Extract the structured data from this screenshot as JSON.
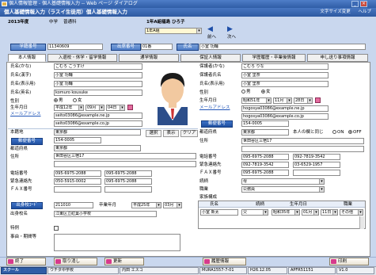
{
  "window": {
    "title": "個人情報管理 - 個人基礎情報入力 -- Web ページ ダイアログ",
    "min": "_",
    "max": "□",
    "close": "×"
  },
  "menubar": {
    "title": "個人基礎情報入力（ラスイ生徒用）個人基礎情報入力",
    "font_size": "文字サイズ変更",
    "help": "ヘルプ"
  },
  "header": {
    "year_label": "2013年度",
    "school_type": "中学",
    "course": "普通科",
    "class_info": "1年A組福島 ひろ子",
    "class_select": "1年A組",
    "prev": "前へ",
    "next": "次へ",
    "student_no_label": "学籍番号",
    "student_no": "11340609",
    "attendance_label": "出席番号",
    "attendance_no": "01番",
    "name_label": "氏名",
    "name": "小室 功輔"
  },
  "tabs": [
    "本人情報",
    "入退校・休学・留学情報",
    "通学情報",
    "保証人情報",
    "学歴履歴・卒業後情報",
    "申し送り事項情報"
  ],
  "left": {
    "kana_label": "氏名(かな)",
    "kana": "こむろ こうすけ",
    "kanji_label": "氏名(漢字)",
    "kanji": "小室 功輔",
    "display_label": "氏名(表示用)",
    "display": "小室 功輔",
    "roman_label": "氏名(英名)",
    "roman": "komuro kousuke",
    "gender_label": "性別",
    "male": "男",
    "female": "女",
    "birth_label": "生年月日",
    "era": "平成12年",
    "month": "09月",
    "day": "04日",
    "mail_label": "メールアドレス",
    "mail1": "seito03086@example.ne.jp",
    "mail2": "seito03086@example.co.jp",
    "honseki_label": "本籍地",
    "honseki": "東京都",
    "zip_btn": "郵便番号",
    "zip": "154-0005",
    "pref_label": "都道府県",
    "pref": "東京都",
    "addr_label": "住所",
    "addr": "世田谷区三宿17",
    "tel_label": "電話番号",
    "tel": "095-6975-2088",
    "tel_b": "095-6975-2088",
    "emerg_label": "緊急連絡先",
    "emerg": "050-5915-0002",
    "emerg_b": "095-6975-2088",
    "fax_label": "ＦＡＸ番号",
    "school_btn": "出身校ｺｰﾄﾞ",
    "school_code": "211010",
    "grad_label": "卒業年月",
    "grad_era": "平成25年",
    "grad_month": "03月",
    "school_name_label": "出身校名",
    "school_name": "江東区立紅葉小学校",
    "special_label": "特例",
    "reason_label": "事由・期間等",
    "photo_select": "選択",
    "photo_show": "表示",
    "photo_clear": "クリア"
  },
  "right": {
    "g_kana_label": "保護者(かな)",
    "g_kana": "こむろ りな",
    "g_kanji_label": "保護者氏名",
    "g_kanji": "小室 里奈",
    "g_display_label": "氏名(表示用)",
    "g_display": "小室 里奈",
    "gender_label": "性別",
    "male": "男",
    "female": "女",
    "birth_label": "生年月日",
    "era": "昭和51年",
    "month": "11月",
    "day": "28日",
    "mail_label": "メールアドレス",
    "mail1": "hogosya03086@example.ne.jp",
    "mail2": "hogosya03086@example.co.jp",
    "zip_btn": "郵便番号",
    "zip": "154-0005",
    "pref_label": "都道府県",
    "pref": "東京都",
    "same_label": "本人の欄と同じ",
    "on": "ON",
    "off": "OFF",
    "addr_label": "住所",
    "addr": "世田谷区三宿17",
    "tel_label": "電話番号",
    "tel": "095-6975-2088",
    "tel_b": "092-7819-3542",
    "emerg_label": "緊急連絡先",
    "emerg": "092-7819-3542",
    "emerg_b": "03-6529-1957",
    "fax_label": "ＦＡＸ番号",
    "fax": "095-6975-2088",
    "rel_label": "続柄",
    "rel": "母",
    "job_label": "職業",
    "job": "公務員",
    "family_label": "家族構成",
    "fam_headers": [
      "氏名",
      "続柄",
      "生年月日",
      "職業"
    ],
    "fam_name": "小室 新太",
    "fam_rel": "父",
    "fam_era": "昭和35年",
    "fam_month": "01月",
    "fam_day": "11日",
    "fam_job": "その他"
  },
  "footer": {
    "close": "終了",
    "undo": "取り消し",
    "update": "更新",
    "history": "履歴情報",
    "print": "印刷"
  },
  "status": {
    "logo": "スクール",
    "s1": "ウチダ中学校",
    "s2": "内田 エスコ",
    "s3": "MURA1557-7-01",
    "s4": "H26.12.05",
    "s5": "APFR51151",
    "s6": "V1.0"
  }
}
